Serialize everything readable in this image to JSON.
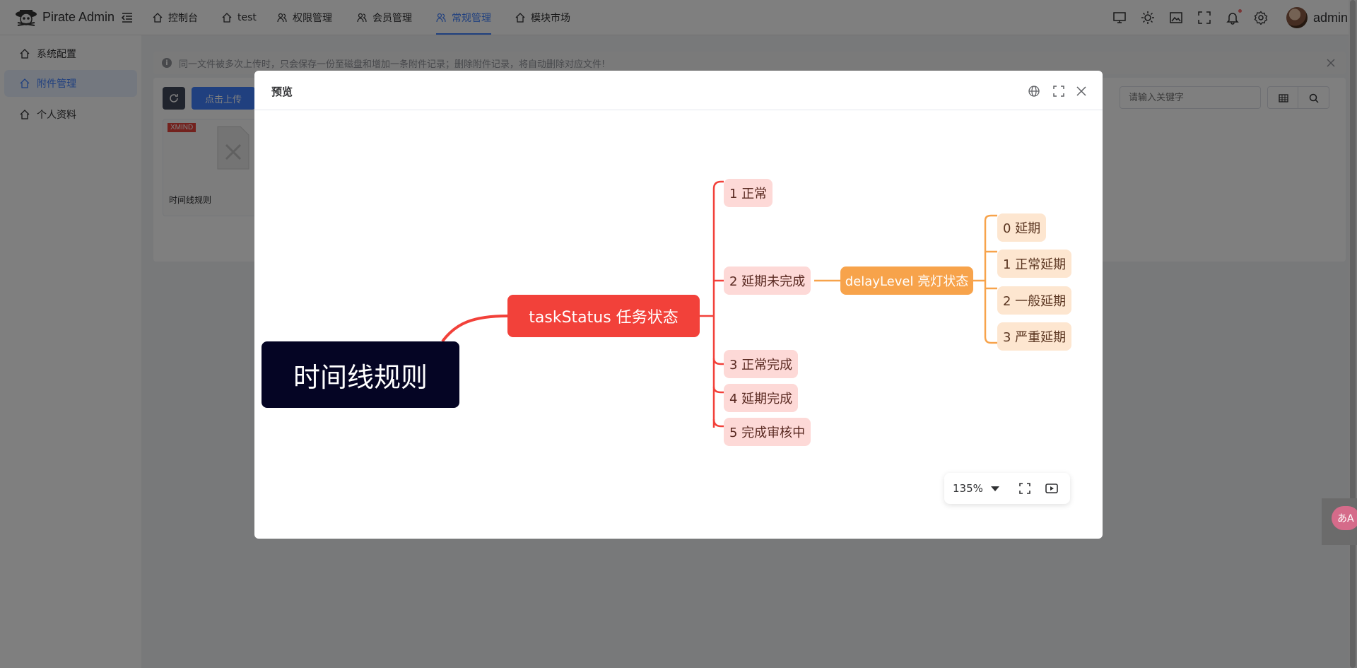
{
  "app": {
    "name": "Pirate Admin",
    "user": "admin"
  },
  "nav_tabs": [
    {
      "label": "控制台",
      "icon": "home-icon"
    },
    {
      "label": "test",
      "icon": "home-icon"
    },
    {
      "label": "权限管理",
      "icon": "users-icon"
    },
    {
      "label": "会员管理",
      "icon": "users-icon"
    },
    {
      "label": "常规管理",
      "icon": "users-icon",
      "active": true
    },
    {
      "label": "模块市场",
      "icon": "home-icon"
    }
  ],
  "sidebar": {
    "items": [
      {
        "label": "系统配置"
      },
      {
        "label": "附件管理",
        "active": true
      },
      {
        "label": "个人资料"
      }
    ]
  },
  "alert": {
    "text": "同一文件被多次上传时，只会保存一份至磁盘和增加一条附件记录；删除附件记录，将自动删除对应文件!"
  },
  "toolbar": {
    "upload_label": "点击上传",
    "search_placeholder": "请输入关键字"
  },
  "file_card": {
    "badge": "XMIND",
    "name": "时间线规则"
  },
  "dialog": {
    "title": "预览",
    "zoom": "135%"
  },
  "mindmap": {
    "root": "时间线规则",
    "main": "taskStatus 任务状态",
    "children": [
      "1 正常",
      "2 延期未完成",
      "3 正常完成",
      "4 延期完成",
      "5 完成审核中"
    ],
    "delay_node": "delayLevel 亮灯状态",
    "delay_levels": [
      "0 延期",
      "1 正常延期",
      "2 一般延期",
      "3 严重延期"
    ]
  },
  "floating_widget": {
    "label": "あA"
  },
  "colors": {
    "accent": "#4080ff",
    "root_node": "#050524",
    "main_node": "#f2413a",
    "sub_node": "#fdd9d7",
    "delay_node": "#f7a34b",
    "level_node": "#fde6d0"
  }
}
